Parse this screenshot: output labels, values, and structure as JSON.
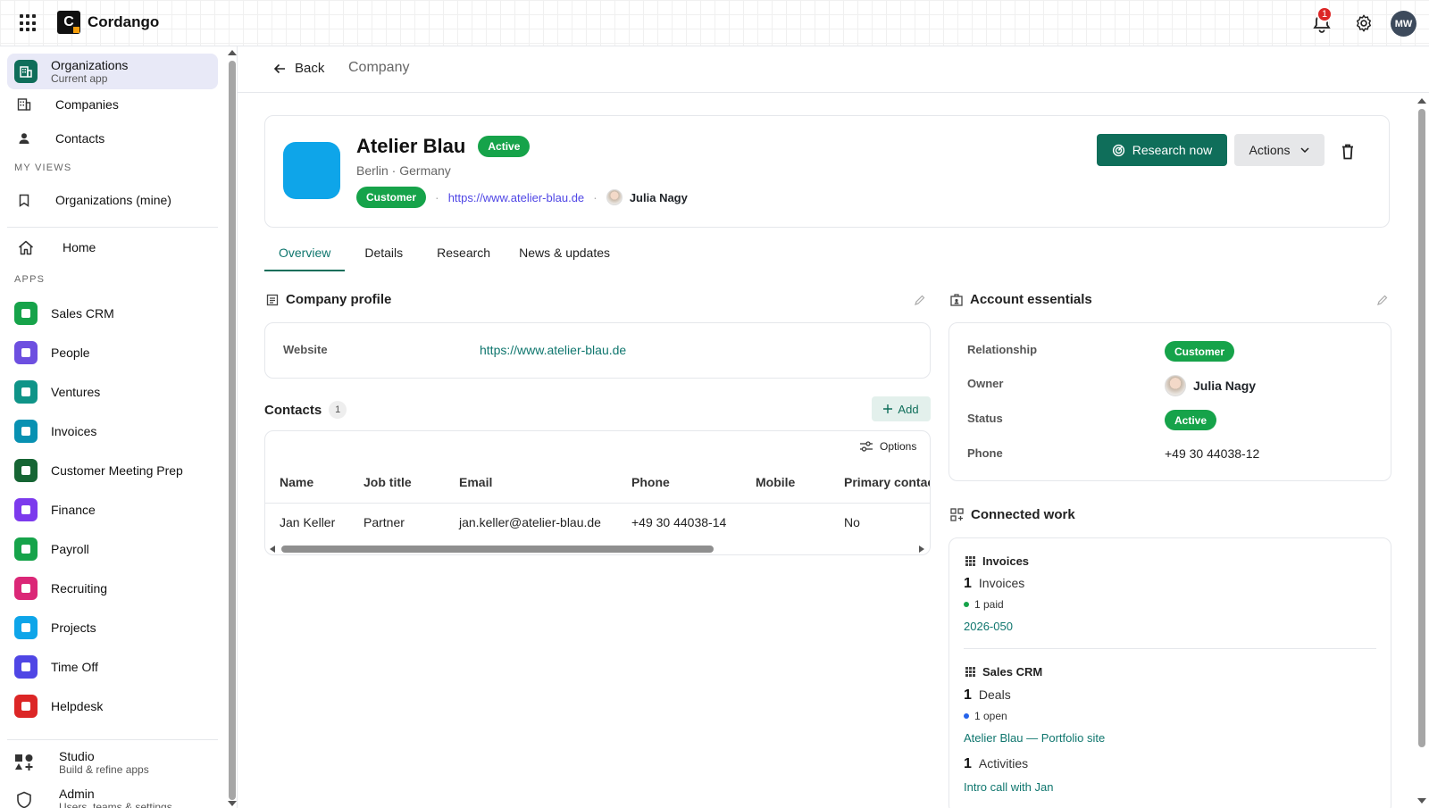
{
  "topbar": {
    "brand_letter": "C",
    "brand_name": "Cordango",
    "notification_count": "1",
    "user_initials": "MW"
  },
  "sidebar": {
    "current": {
      "label": "Organizations",
      "sub": "Current app"
    },
    "items": [
      {
        "label": "Companies",
        "icon": "building-icon"
      },
      {
        "label": "Contacts",
        "icon": "person-icon"
      }
    ],
    "my_views_label": "MY VIEWS",
    "my_views": [
      {
        "label": "Organizations (mine)",
        "icon": "bookmark-icon"
      }
    ],
    "home_label": "Home",
    "apps_label": "APPS",
    "apps": [
      {
        "label": "Sales CRM",
        "color": "#16a34a",
        "icon": "handshake-icon"
      },
      {
        "label": "People",
        "color": "#6d4fe0",
        "icon": "people-icon"
      },
      {
        "label": "Ventures",
        "color": "#0f9488",
        "icon": "grid-icon"
      },
      {
        "label": "Invoices",
        "color": "#0891b2",
        "icon": "document-icon"
      },
      {
        "label": "Customer Meeting Prep",
        "color": "#166534",
        "icon": "calendar-icon"
      },
      {
        "label": "Finance",
        "color": "#7c3aed",
        "icon": "chart-icon"
      },
      {
        "label": "Payroll",
        "color": "#16a34a",
        "icon": "money-icon"
      },
      {
        "label": "Recruiting",
        "color": "#db2777",
        "icon": "badge-icon"
      },
      {
        "label": "Projects",
        "color": "#0ea5e9",
        "icon": "clipboard-icon"
      },
      {
        "label": "Time Off",
        "color": "#4f46e5",
        "icon": "grid-icon"
      },
      {
        "label": "Helpdesk",
        "color": "#dc2626",
        "icon": "lifebuoy-icon"
      }
    ],
    "studio": {
      "label": "Studio",
      "sub": "Build & refine apps"
    },
    "admin": {
      "label": "Admin",
      "sub": "Users, teams & settings"
    }
  },
  "subheader": {
    "back_label": "Back",
    "breadcrumb": "Company"
  },
  "company": {
    "name": "Atelier Blau",
    "status": "Active",
    "location": "Berlin · Germany",
    "relationship": "Customer",
    "website": "https://www.atelier-blau.de",
    "owner": "Julia Nagy",
    "research_button": "Research now",
    "actions_button": "Actions"
  },
  "tabs": [
    "Overview",
    "Details",
    "Research",
    "News & updates"
  ],
  "profile": {
    "title": "Company profile",
    "website_label": "Website",
    "website_value": "https://www.atelier-blau.de"
  },
  "contacts": {
    "title": "Contacts",
    "count": "1",
    "add_label": "Add",
    "options_label": "Options",
    "columns": [
      "Name",
      "Job title",
      "Email",
      "Phone",
      "Mobile",
      "Primary contact"
    ],
    "rows": [
      {
        "name": "Jan Keller",
        "job_title": "Partner",
        "email": "jan.keller@atelier-blau.de",
        "phone": "+49 30 44038-14",
        "mobile": "",
        "primary": "No"
      }
    ]
  },
  "essentials": {
    "title": "Account essentials",
    "relationship_label": "Relationship",
    "relationship_value": "Customer",
    "owner_label": "Owner",
    "owner_value": "Julia Nagy",
    "status_label": "Status",
    "status_value": "Active",
    "phone_label": "Phone",
    "phone_value": "+49 30 44038-12"
  },
  "connected": {
    "title": "Connected work",
    "groups": [
      {
        "title": "Invoices",
        "count": "1",
        "unit": "Invoices",
        "status": "1 paid",
        "status_color": "#16a34a",
        "link": "2026-050"
      },
      {
        "title": "Sales CRM",
        "count": "1",
        "unit": "Deals",
        "status": "1 open",
        "status_color": "#2563eb",
        "link": "Atelier Blau — Portfolio site",
        "extra_count": "1",
        "extra_unit": "Activities",
        "extra_link": "Intro call with Jan"
      }
    ]
  }
}
